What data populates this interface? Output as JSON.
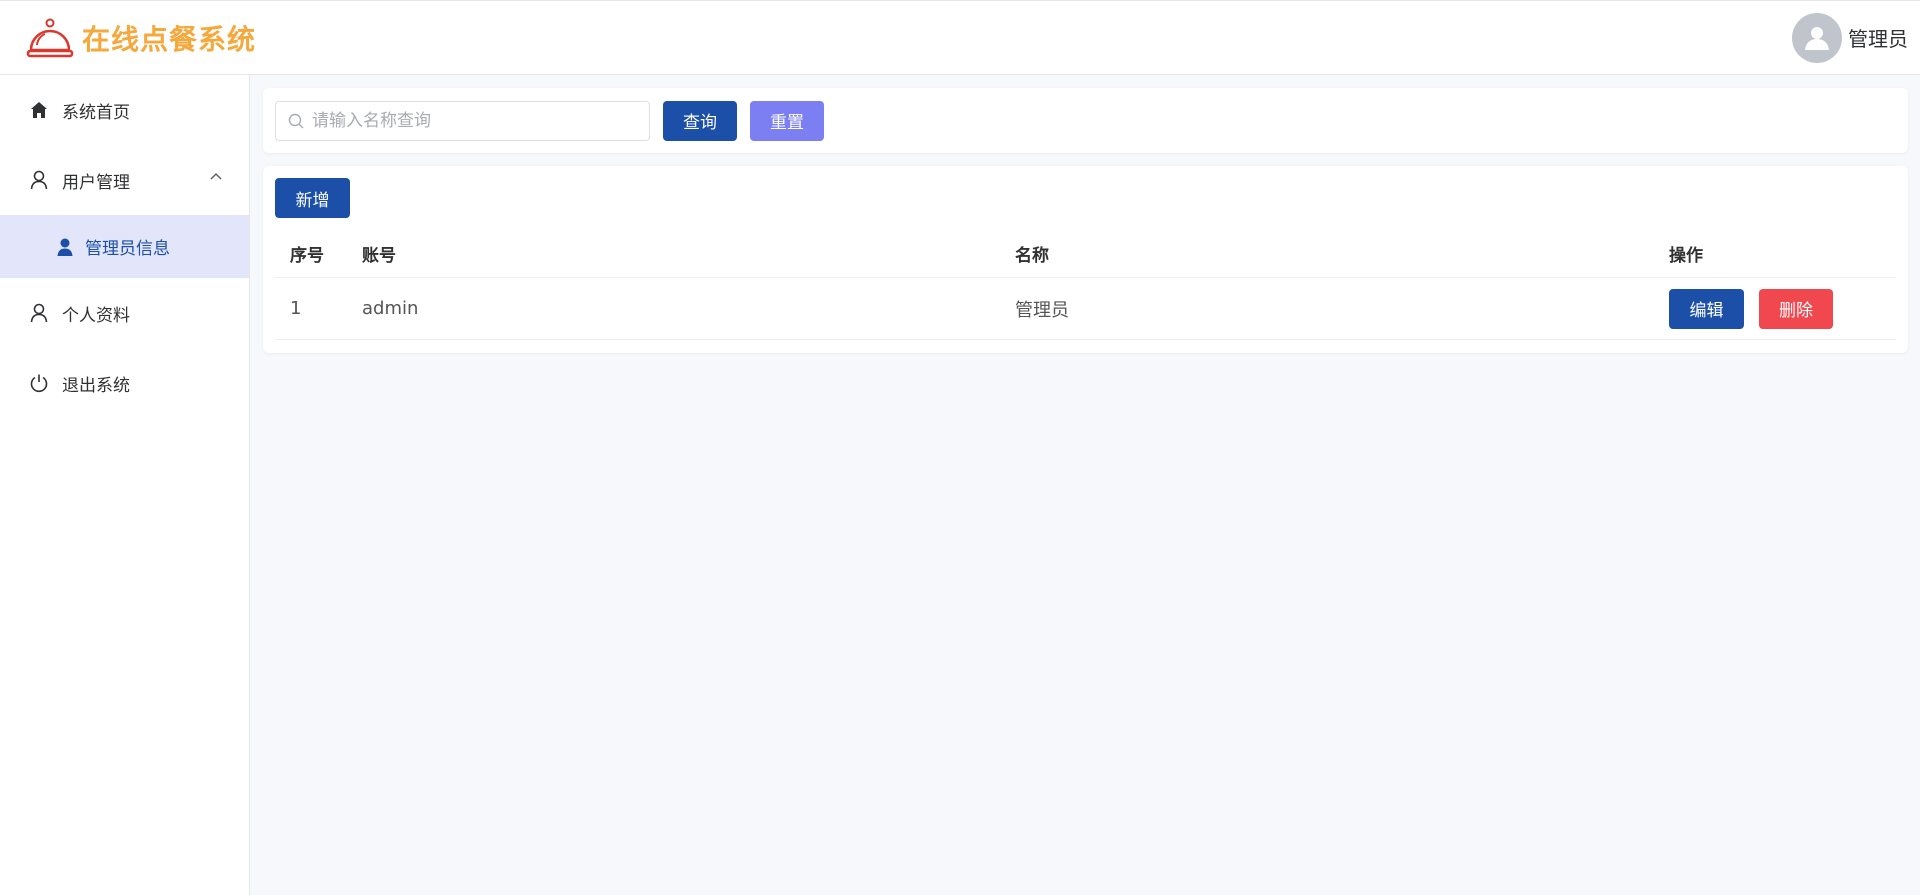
{
  "header": {
    "app_title": "在线点餐系统",
    "user_name": "管理员"
  },
  "sidebar": {
    "items": [
      {
        "label": "系统首页",
        "icon": "home-icon"
      },
      {
        "label": "用户管理",
        "icon": "user-icon",
        "expanded": true
      },
      {
        "label": "管理员信息",
        "icon": "user-filled-icon",
        "active": true
      },
      {
        "label": "个人资料",
        "icon": "user-icon"
      },
      {
        "label": "退出系统",
        "icon": "power-icon"
      }
    ]
  },
  "search": {
    "placeholder": "请输入名称查询",
    "value": "",
    "query_label": "查询",
    "reset_label": "重置"
  },
  "table": {
    "add_label": "新增",
    "columns": [
      "序号",
      "账号",
      "名称",
      "操作"
    ],
    "rows": [
      {
        "index": "1",
        "account": "admin",
        "name": "管理员",
        "edit_label": "编辑",
        "delete_label": "删除"
      }
    ]
  },
  "colors": {
    "brand": "#f5a83c",
    "primary": "#1b4fa8",
    "reset": "#7b7ff1",
    "danger": "#f0484e",
    "active_bg": "#e3e6fb"
  }
}
